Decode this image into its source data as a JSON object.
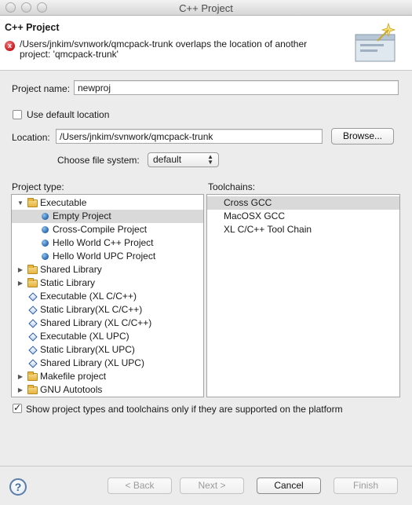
{
  "window": {
    "title": "C++ Project"
  },
  "banner": {
    "title": "C++ Project",
    "error_message": "/Users/jnkim/svnwork/qmcpack-trunk overlaps the location of another project: 'qmcpack-trunk'"
  },
  "project_name": {
    "label": "Project name:",
    "value": "newproj"
  },
  "use_default_location": {
    "label": "Use default location",
    "checked": false
  },
  "location": {
    "label": "Location:",
    "value": "/Users/jnkim/svnwork/qmcpack-trunk",
    "browse_label": "Browse..."
  },
  "file_system": {
    "label": "Choose file system:",
    "value": "default"
  },
  "project_type": {
    "header": "Project type:",
    "items": [
      {
        "label": "Executable",
        "kind": "folder",
        "expanded": true,
        "level": 0
      },
      {
        "label": "Empty Project",
        "kind": "bullet",
        "level": 1,
        "selected": true
      },
      {
        "label": "Cross-Compile Project",
        "kind": "bullet",
        "level": 1
      },
      {
        "label": "Hello World C++ Project",
        "kind": "bullet",
        "level": 1
      },
      {
        "label": "Hello World UPC Project",
        "kind": "bullet",
        "level": 1
      },
      {
        "label": "Shared Library",
        "kind": "folder",
        "expanded": false,
        "level": 0
      },
      {
        "label": "Static Library",
        "kind": "folder",
        "expanded": false,
        "level": 0
      },
      {
        "label": "Executable (XL C/C++)",
        "kind": "diamond",
        "level": 0
      },
      {
        "label": "Static Library(XL C/C++)",
        "kind": "diamond",
        "level": 0
      },
      {
        "label": "Shared Library (XL C/C++)",
        "kind": "diamond",
        "level": 0
      },
      {
        "label": "Executable (XL UPC)",
        "kind": "diamond",
        "level": 0
      },
      {
        "label": "Static Library(XL UPC)",
        "kind": "diamond",
        "level": 0
      },
      {
        "label": "Shared Library (XL UPC)",
        "kind": "diamond",
        "level": 0
      },
      {
        "label": "Makefile project",
        "kind": "folder",
        "expanded": false,
        "level": 0
      },
      {
        "label": "GNU Autotools",
        "kind": "folder",
        "expanded": false,
        "level": 0
      }
    ]
  },
  "toolchains": {
    "header": "Toolchains:",
    "items": [
      {
        "label": "Cross GCC",
        "selected": true
      },
      {
        "label": "MacOSX GCC"
      },
      {
        "label": "XL C/C++ Tool Chain"
      }
    ]
  },
  "show_supported": {
    "label": "Show project types and toolchains only if they are supported on the platform",
    "checked": true
  },
  "buttons": {
    "help": "?",
    "back": "< Back",
    "next": "Next >",
    "cancel": "Cancel",
    "finish": "Finish"
  },
  "colors": {
    "error": "#c8141a",
    "selection": "#d9d9d9",
    "window_bg": "#ececec"
  }
}
